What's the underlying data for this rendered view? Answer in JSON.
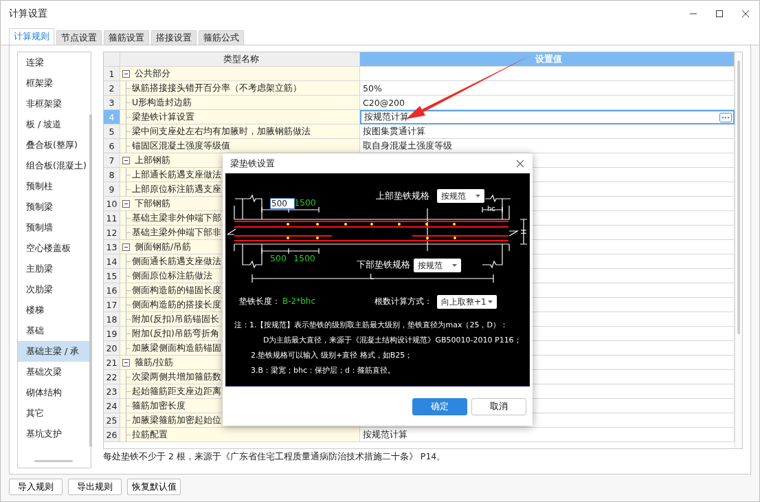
{
  "window": {
    "title": "计算设置"
  },
  "tabs": [
    {
      "label": "计算规则",
      "selected": true
    },
    {
      "label": "节点设置",
      "selected": false
    },
    {
      "label": "箍筋设置",
      "selected": false
    },
    {
      "label": "搭接设置",
      "selected": false
    },
    {
      "label": "箍筋公式",
      "selected": false
    }
  ],
  "sidebar": {
    "items": [
      {
        "label": "连梁",
        "selected": false
      },
      {
        "label": "框架梁",
        "selected": false
      },
      {
        "label": "非框架梁",
        "selected": false
      },
      {
        "label": "板 / 坡道",
        "selected": false
      },
      {
        "label": "叠合板(整厚)",
        "selected": false
      },
      {
        "label": "组合板(混凝土)",
        "selected": false
      },
      {
        "label": "预制柱",
        "selected": false
      },
      {
        "label": "预制梁",
        "selected": false
      },
      {
        "label": "预制墙",
        "selected": false
      },
      {
        "label": "空心楼盖板",
        "selected": false
      },
      {
        "label": "主肋梁",
        "selected": false
      },
      {
        "label": "次肋梁",
        "selected": false
      },
      {
        "label": "楼梯",
        "selected": false
      },
      {
        "label": "基础",
        "selected": false
      },
      {
        "label": "基础主梁 / 承",
        "selected": true
      },
      {
        "label": "基础次梁",
        "selected": false
      },
      {
        "label": "砌体结构",
        "selected": false
      },
      {
        "label": "其它",
        "selected": false
      },
      {
        "label": "基坑支护",
        "selected": false
      }
    ]
  },
  "table": {
    "columns": [
      "类型名称",
      "设置值"
    ],
    "groups": [
      {
        "index": "1",
        "name": "公共部分",
        "expanded": true,
        "selected": false,
        "children": [
          {
            "index": "2",
            "name": "纵筋搭接接头错开百分率（不考虑架立筋）",
            "value": "50%",
            "selected": false
          },
          {
            "index": "3",
            "name": "U形构造封边筋",
            "value": "C20@200",
            "selected": false
          },
          {
            "index": "4",
            "name": "梁垫铁计算设置",
            "value": "按规范计算",
            "selected": true
          },
          {
            "index": "5",
            "name": "梁中间支座处左右均有加腋时，加腋钢筋做法",
            "value": "按图集贯通计算",
            "selected": false
          },
          {
            "index": "6",
            "name": "锚固区混凝土强度等级值",
            "value": "取自身混凝土强度等级",
            "selected": false
          }
        ]
      },
      {
        "index": "7",
        "name": "上部钢筋",
        "expanded": true,
        "selected": false,
        "children": [
          {
            "index": "8",
            "name": "上部通长筋遇支座做法",
            "selected": false
          },
          {
            "index": "9",
            "name": "上部原位标注筋遇支座",
            "selected": false
          }
        ]
      },
      {
        "index": "10",
        "name": "下部钢筋",
        "expanded": true,
        "selected": false,
        "children": [
          {
            "index": "11",
            "name": "基础主梁非外伸端下部",
            "selected": false
          },
          {
            "index": "12",
            "name": "基础主梁外伸端下部非",
            "selected": false
          }
        ]
      },
      {
        "index": "13",
        "name": "侧面钢筋/吊筋",
        "expanded": true,
        "selected": false,
        "children": [
          {
            "index": "14",
            "name": "侧面通长筋遇支座做法",
            "selected": false
          },
          {
            "index": "15",
            "name": "侧面原位标注筋做法",
            "selected": false
          },
          {
            "index": "16",
            "name": "侧面构造筋的锚固长度",
            "selected": false
          },
          {
            "index": "17",
            "name": "侧面构造筋的搭接长度",
            "selected": false
          },
          {
            "index": "18",
            "name": "附加(反扣)吊筋锚固长",
            "selected": false
          },
          {
            "index": "19",
            "name": "附加(反扣)吊筋弯折角",
            "selected": false
          },
          {
            "index": "20",
            "name": "加腋梁侧面构造筋锚固",
            "selected": false
          }
        ]
      },
      {
        "index": "21",
        "name": "箍筋/拉筋",
        "expanded": true,
        "selected": false,
        "children": [
          {
            "index": "22",
            "name": "次梁两侧共增加箍筋数",
            "selected": false
          },
          {
            "index": "23",
            "name": "起始箍筋距支座边距离",
            "selected": false
          },
          {
            "index": "24",
            "name": "箍筋加密长度",
            "selected": false
          },
          {
            "index": "25",
            "name": "加腋梁箍筋加密起始位",
            "selected": false
          },
          {
            "index": "26",
            "name": "拉筋配置",
            "value": "按规范计算",
            "selected": false
          }
        ]
      }
    ]
  },
  "hint": "每处垫铁不少于 2 根，来源于《广东省住宅工程质量通病防治技术措施二十条》 P14。",
  "buttons": [
    "导入规则",
    "导出规则",
    "恢复默认值"
  ],
  "dialog": {
    "title": "梁垫铁设置",
    "top_spec": {
      "label": "上部垫铁规格",
      "value": "按规范"
    },
    "bottom_spec": {
      "label": "下部垫铁规格",
      "value": "按规范"
    },
    "top_input": "500",
    "top_dim": "1500",
    "bottom_dims": [
      "500",
      "1500"
    ],
    "hc": "hc",
    "length": "L",
    "height": "H",
    "pad_length": {
      "label": "垫铁长度：",
      "value": "B-2*bhc"
    },
    "count_method": {
      "label": "根数计算方式：",
      "value": "向上取整+1"
    },
    "notes": [
      "注：1.【按规范】表示垫铁的级别取主筋最大级别，垫铁直径为max（25，D）：",
      "D为主筋最大直径，来源于《混凝土结构设计规范》GB50010-2010 P116；",
      "2.垫铁规格可以输入 级别+直径 格式，如B25；",
      "3.B：梁宽；bhc：保护层；d：箍筋直径。"
    ],
    "buttons": [
      {
        "label": "确定",
        "primary": true
      },
      {
        "label": "取消",
        "primary": false
      }
    ]
  }
}
